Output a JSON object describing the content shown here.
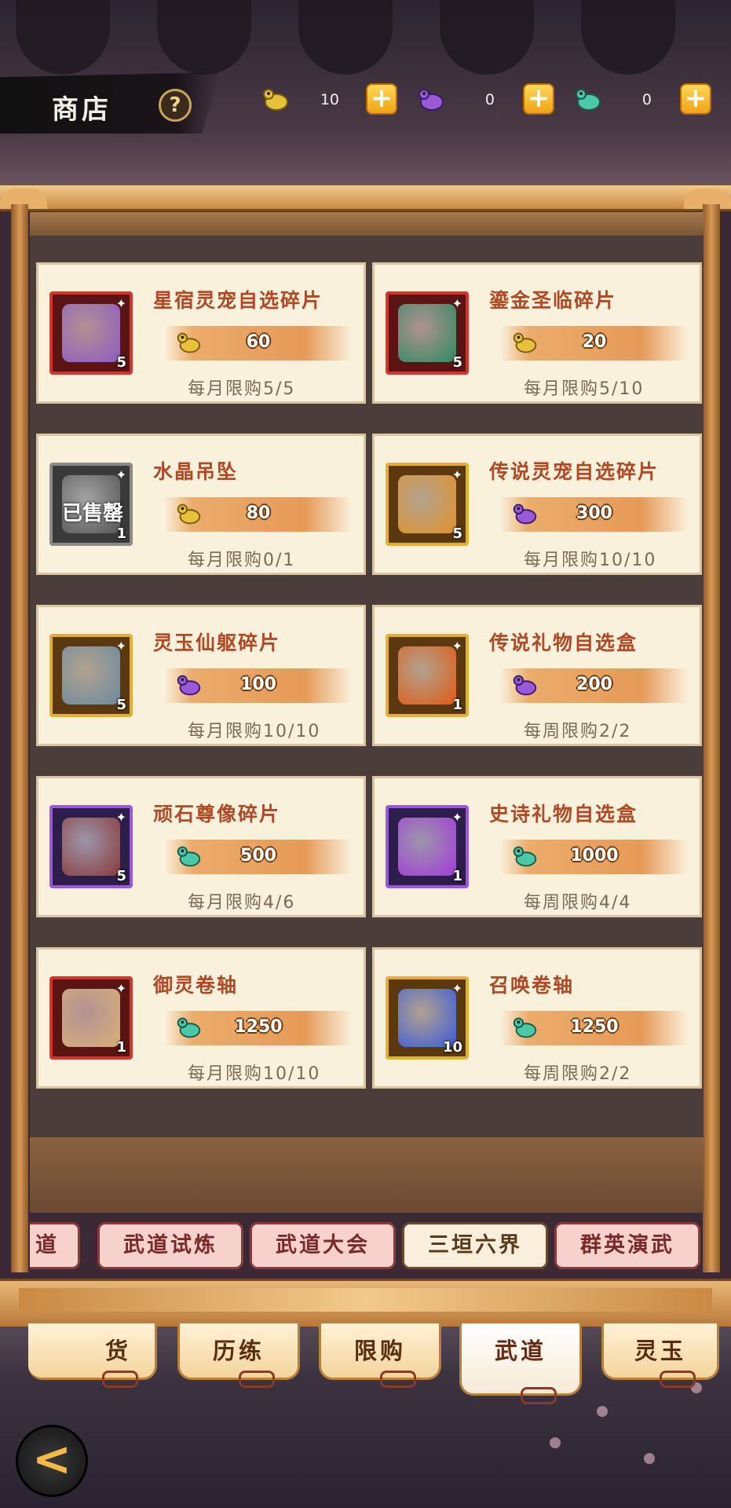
{
  "header": {
    "title": "商店",
    "help_icon": "?",
    "currencies": [
      {
        "icon": "gold-frog-icon",
        "amount": "10",
        "color": "#e6c23a"
      },
      {
        "icon": "purple-frog-icon",
        "amount": "0",
        "color": "#9a5ad8"
      },
      {
        "icon": "jade-frog-icon",
        "amount": "0",
        "color": "#4ac8a8"
      }
    ],
    "plus_label": "+"
  },
  "items": [
    {
      "name": "星宿灵宠自选碎片",
      "price": "60",
      "currency": "gold",
      "limit": "每月限购5/5",
      "qty": "5",
      "frame": "red",
      "art": "#8f5bc2"
    },
    {
      "name": "鎏金圣临碎片",
      "price": "20",
      "currency": "gold",
      "limit": "每月限购5/10",
      "qty": "5",
      "frame": "red",
      "art": "#2e8a62"
    },
    {
      "name": "水晶吊坠",
      "price": "80",
      "currency": "gold",
      "limit": "每月限购0/1",
      "qty": "1",
      "frame": "gray",
      "art": "#555555",
      "sold": "已售罄"
    },
    {
      "name": "传说灵宠自选碎片",
      "price": "300",
      "currency": "purple",
      "limit": "每月限购10/10",
      "qty": "5",
      "frame": "gold",
      "art": "#e2922a"
    },
    {
      "name": "灵玉仙躯碎片",
      "price": "100",
      "currency": "purple",
      "limit": "每月限购10/10",
      "qty": "5",
      "frame": "gold",
      "art": "#6a8aa0"
    },
    {
      "name": "传说礼物自选盒",
      "price": "200",
      "currency": "purple",
      "limit": "每周限购2/2",
      "qty": "1",
      "frame": "gold",
      "art": "#e05a14"
    },
    {
      "name": "顽石尊像碎片",
      "price": "500",
      "currency": "jade",
      "limit": "每月限购4/6",
      "qty": "5",
      "frame": "purple",
      "art": "#8a3a3a"
    },
    {
      "name": "史诗礼物自选盒",
      "price": "1000",
      "currency": "jade",
      "limit": "每周限购4/4",
      "qty": "1",
      "frame": "purple",
      "art": "#a23ad8"
    },
    {
      "name": "御灵卷轴",
      "price": "1250",
      "currency": "jade",
      "limit": "每月限购10/10",
      "qty": "1",
      "frame": "red",
      "art": "#d8b07a"
    },
    {
      "name": "召唤卷轴",
      "price": "1250",
      "currency": "jade",
      "limit": "每周限购2/2",
      "qty": "10",
      "frame": "gold",
      "art": "#3a5ad8"
    }
  ],
  "sub_tabs": [
    "道",
    "武道试炼",
    "武道大会",
    "三垣六界",
    "群英演武"
  ],
  "sub_tab_active": "三垣六界",
  "bottom_tabs": [
    "货",
    "历练",
    "限购",
    "武道",
    "灵玉"
  ],
  "bottom_tab_active": "武道",
  "back_icon": "<"
}
